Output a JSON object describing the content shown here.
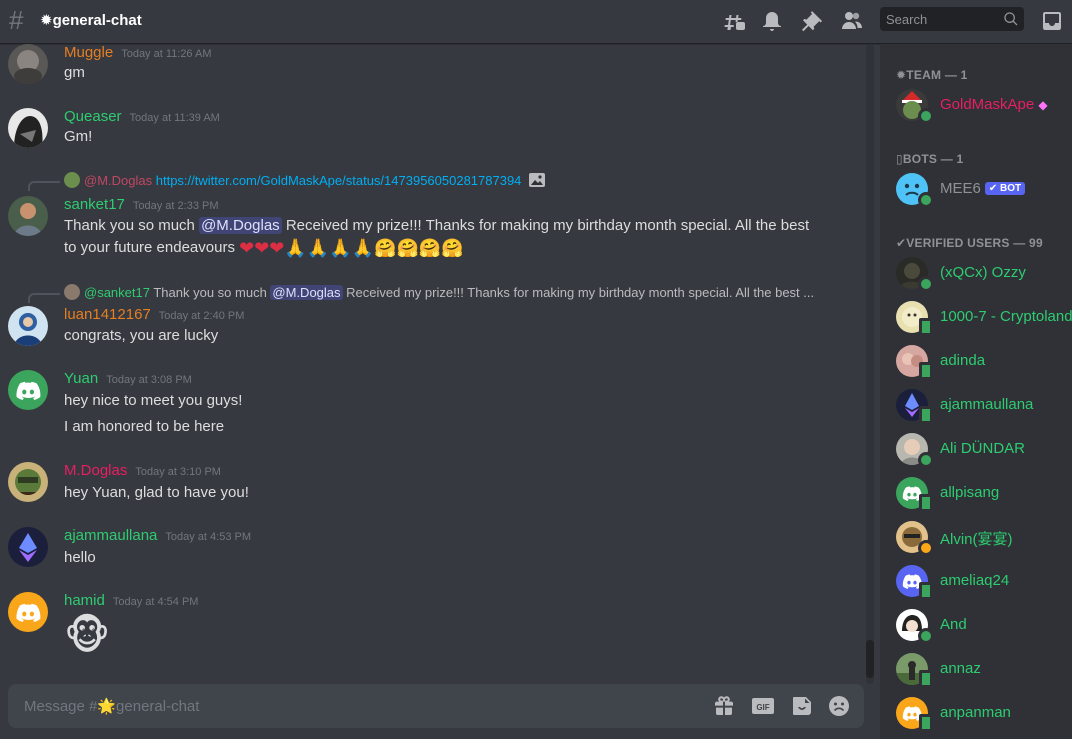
{
  "header": {
    "channel_title": "✹general-chat",
    "search_placeholder": "Search"
  },
  "messages": [
    {
      "author": "Muggle",
      "author_color": "#e67e22",
      "timestamp": "Today at 11:26 AM",
      "text": "gm"
    },
    {
      "author": "Queaser",
      "author_color": "#2ecc71",
      "timestamp": "Today at 11:39 AM",
      "text": "Gm!"
    },
    {
      "reply": {
        "author": "@M.Doglas",
        "text": "https://twitter.com/GoldMaskApe/status/1473956050281787394"
      },
      "author": "sanket17",
      "author_color": "#2ecc71",
      "timestamp": "Today at 2:33 PM",
      "text_before": "Thank you so much ",
      "mention": "@M.Doglas",
      "text_after": " Received my prize!!! Thanks for making my birthday month special. All the best",
      "text_line2": "to your future endeavours"
    },
    {
      "reply": {
        "author": "@sanket17",
        "text_before": "Thank you so much ",
        "mention": "@M.Doglas",
        "text_after": " Received my prize!!! Thanks for making my birthday month special. All the best ..."
      },
      "author": "luan1412167",
      "author_color": "#e67e22",
      "timestamp": "Today at 2:40 PM",
      "text": "congrats, you are lucky"
    },
    {
      "author": "Yuan",
      "author_color": "#2ecc71",
      "timestamp": "Today at 3:08 PM",
      "text": "hey nice to meet you guys!",
      "text_line2": "I am honored to be here"
    },
    {
      "author": "M.Doglas",
      "author_color": "#e91e63",
      "timestamp": "Today at 3:10 PM",
      "text": "hey Yuan, glad to have you!"
    },
    {
      "author": "ajammaullana",
      "author_color": "#2ecc71",
      "timestamp": "Today at 4:53 PM",
      "text": "hello"
    },
    {
      "author": "hamid",
      "author_color": "#2ecc71",
      "timestamp": "Today at 4:54 PM",
      "text": "🐵"
    }
  ],
  "composer": {
    "placeholder": "Message #🌟general-chat"
  },
  "members": {
    "sections": [
      {
        "title": "✹TEAM — 1"
      },
      {
        "title": "▯BOTS — 1"
      },
      {
        "title": "✔VERIFIED USERS — 99"
      }
    ],
    "team": [
      {
        "name": "GoldMaskApe",
        "color": "#e91e63"
      }
    ],
    "bots": [
      {
        "name": "MEE6",
        "badge": "✔ BOT",
        "color": "#8e9297"
      }
    ],
    "verified": [
      {
        "name": "(xQCx) Ozzy"
      },
      {
        "name": "1000-7 - Cryptoland"
      },
      {
        "name": "adinda"
      },
      {
        "name": "ajammaullana"
      },
      {
        "name": "Ali DÜNDAR"
      },
      {
        "name": "allpisang"
      },
      {
        "name": "Alvin(宴宴)"
      },
      {
        "name": "ameliaq24"
      },
      {
        "name": "And"
      },
      {
        "name": "annaz"
      },
      {
        "name": "anpanman"
      }
    ],
    "verified_color": "#2ecc71"
  },
  "colors": {
    "background": "#36393f",
    "sidebar": "#2f3136",
    "link": "#00aff4",
    "online": "#3ba55d",
    "blurple": "#5865f2"
  }
}
